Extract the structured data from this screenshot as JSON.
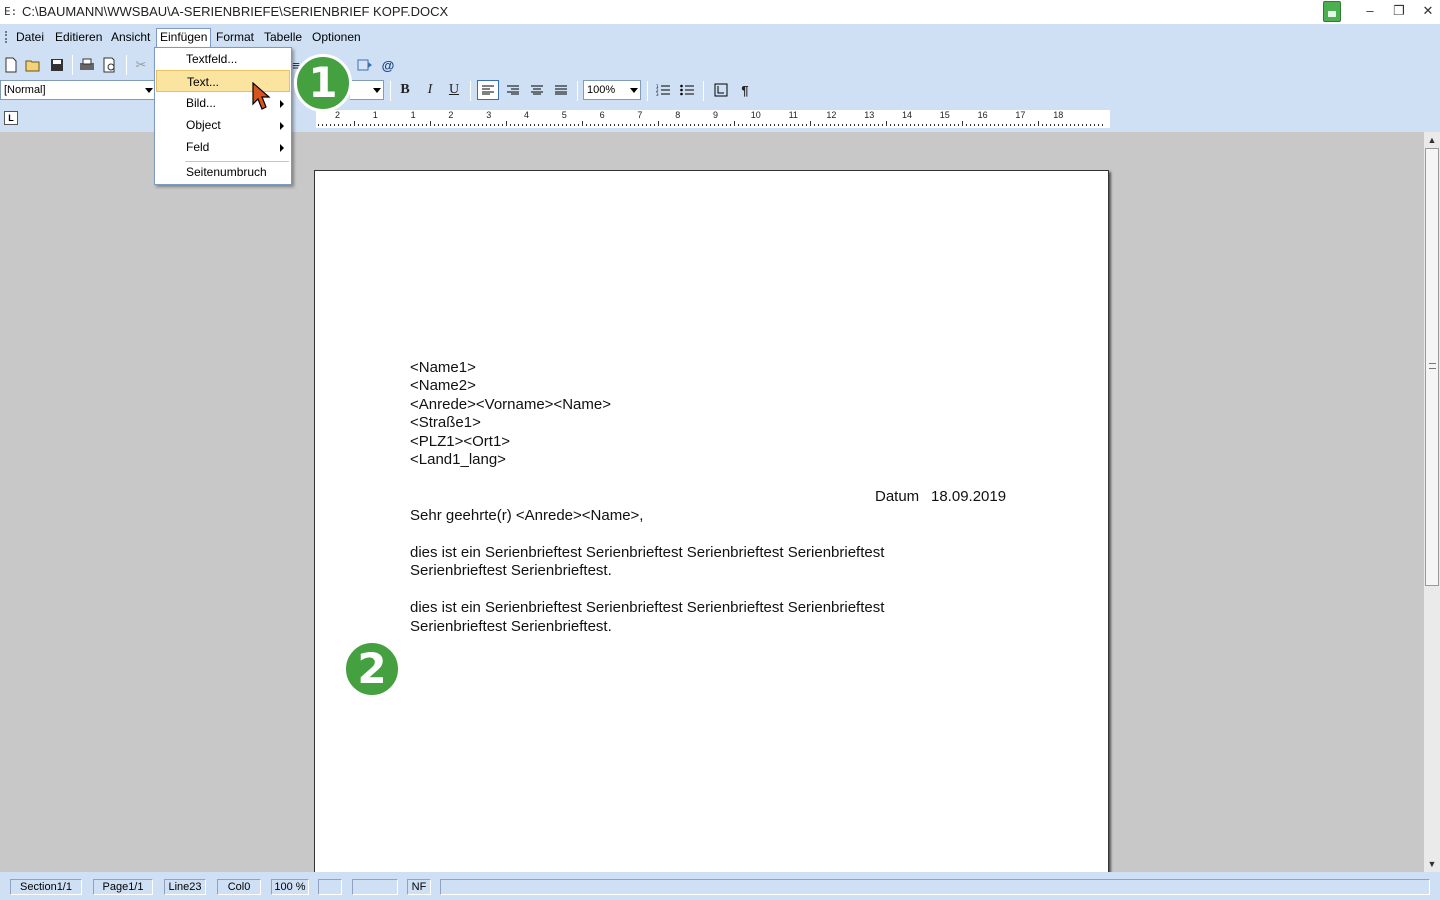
{
  "titlebar": {
    "app_icon": "E:",
    "title": "C:\\BAUMANN\\WWSBAU\\A-SERIENBRIEFE\\SERIENBRIEF KOPF.DOCX",
    "minimize": "–",
    "restore": "❐",
    "close": "✕"
  },
  "menubar": {
    "items": [
      "Datei",
      "Editieren",
      "Ansicht",
      "Einfügen",
      "Format",
      "Tabelle",
      "Optionen"
    ]
  },
  "toolbar": {
    "style_value": "[Normal]",
    "zoom_value": "100%",
    "bold": "B",
    "italic": "I",
    "underline": "U",
    "pilcrow": "¶",
    "at": "@"
  },
  "dropdown": {
    "items": [
      {
        "label": "Textfeld...",
        "submenu": false
      },
      {
        "label": "Text...",
        "submenu": false,
        "highlighted": true
      },
      {
        "label": "Bild...",
        "submenu": true
      },
      {
        "label": "Object",
        "submenu": true
      },
      {
        "label": "Feld",
        "submenu": true
      },
      {
        "label": "Seitenumbruch",
        "submenu": false
      }
    ]
  },
  "ruler": {
    "corner": "L",
    "labels": [
      "2",
      "1",
      "1",
      "2",
      "3",
      "4",
      "5",
      "6",
      "7",
      "8",
      "9",
      "10",
      "11",
      "12",
      "13",
      "14",
      "15",
      "16",
      "17",
      "18"
    ]
  },
  "document": {
    "address_lines": [
      "<Name1>",
      "<Name2>",
      "<Anrede><Vorname><Name>",
      "<Straße1>",
      "<PLZ1><Ort1>",
      "<Land1_lang>"
    ],
    "date_label": "Datum",
    "date_value": "18.09.2019",
    "salutation": "Sehr geehrte(r) <Anrede><Name>,",
    "paragraph1_line1": "dies ist ein Serienbrieftest Serienbrieftest Serienbrieftest Serienbrieftest",
    "paragraph1_line2": "Serienbrieftest Serienbrieftest.",
    "paragraph2_line1": "dies ist ein Serienbrieftest Serienbrieftest Serienbrieftest Serienbrieftest",
    "paragraph2_line2": "Serienbrieftest Serienbrieftest."
  },
  "statusbar": {
    "section": "Section1/1",
    "page": "Page1/1",
    "line": "Line23",
    "col": "Col0",
    "zoom": "100 %",
    "mode": "NF"
  },
  "callouts": {
    "one": "1",
    "two": "2"
  },
  "colors": {
    "chrome": "#cfe0f5",
    "workspace": "#c8c8c8",
    "menu_highlight": "#fbe3a0",
    "callout": "#45a03f"
  }
}
